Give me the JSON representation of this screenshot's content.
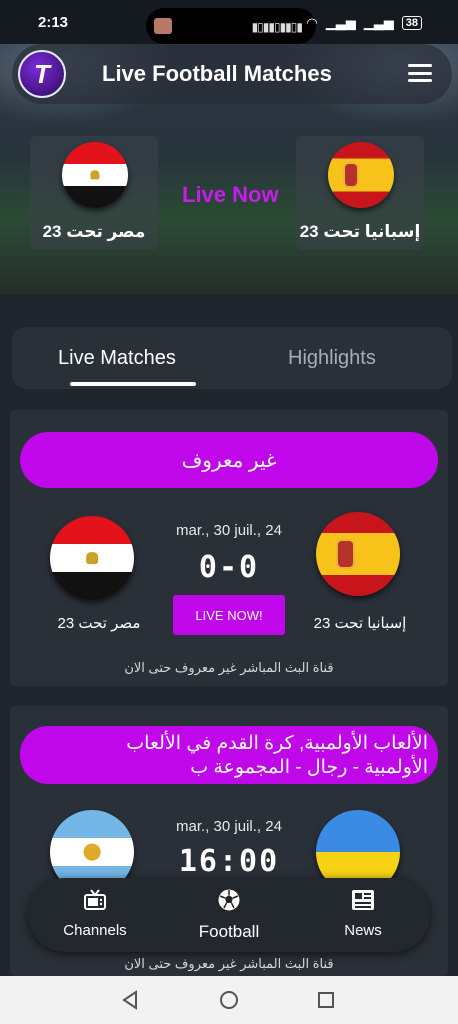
{
  "status_bar": {
    "time": "2:13",
    "battery": "38"
  },
  "app": {
    "title": "Live Football Matches",
    "logo_letter": "T"
  },
  "featured": {
    "home": {
      "name": "مصر تحت 23",
      "flag": "egypt"
    },
    "away": {
      "name": "إسبانيا تحت 23",
      "flag": "spain"
    },
    "status": "Live Now"
  },
  "tabs": [
    {
      "label": "Live Matches",
      "active": true
    },
    {
      "label": "Highlights",
      "active": false
    }
  ],
  "matches": [
    {
      "league": "غير معروف",
      "date": "mar., 30 juil., 24",
      "score": "0-0",
      "live_label": "LIVE NOW!",
      "home": {
        "name": "مصر تحت 23",
        "flag": "egypt"
      },
      "away": {
        "name": "إسبانيا تحت 23",
        "flag": "spain"
      },
      "channel": "قناة البث المباشر غير معروف حتى الان"
    },
    {
      "league": "الألعاب الأولمبية, كرة القدم في الألعاب الأولمبية - رجال - المجموعة ب",
      "date": "mar., 30 juil., 24",
      "time": "16:00",
      "home": {
        "flag": "argentina"
      },
      "away": {
        "flag": "ukraine"
      },
      "channel": "قناة البث المباشر غير معروف حتى الان"
    }
  ],
  "bottom_nav": [
    {
      "label": "Channels",
      "icon": "tv-icon",
      "active": false
    },
    {
      "label": "Football",
      "icon": "soccer-ball-icon",
      "active": true
    },
    {
      "label": "News",
      "icon": "newspaper-icon",
      "active": false
    }
  ],
  "colors": {
    "accent": "#c007e9",
    "background": "#1f252c",
    "card": "#2a3038"
  }
}
